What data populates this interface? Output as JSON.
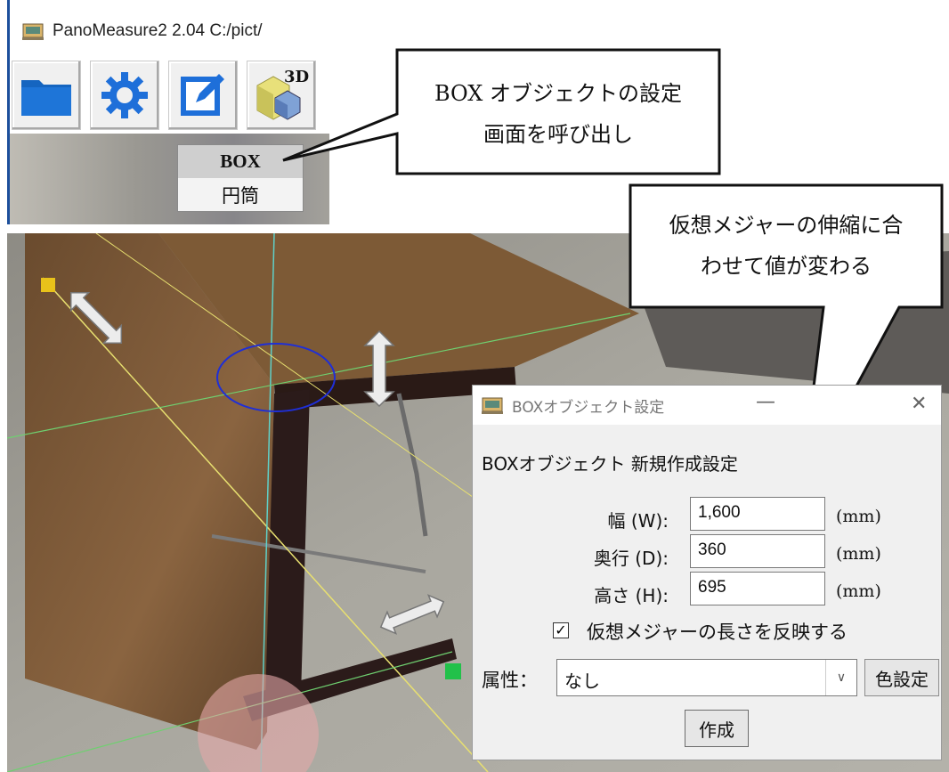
{
  "app": {
    "title": "PanoMeasure2 2.04  C:/pict/",
    "toolbar": {
      "buttons": [
        {
          "name": "open-folder",
          "icon": "folder-icon"
        },
        {
          "name": "settings",
          "icon": "gear-icon"
        },
        {
          "name": "edit",
          "icon": "edit-icon"
        },
        {
          "name": "3d-object",
          "icon": "3d-box-icon",
          "badge": "3D"
        }
      ]
    },
    "shape_menu": {
      "items": [
        "BOX",
        "円筒"
      ],
      "selected": "BOX"
    }
  },
  "callouts": {
    "box_settings": {
      "line1": "BOX オブジェクトの設定",
      "line2": "画面を呼び出し"
    },
    "measure_note": {
      "line1": "仮想メジャーの伸縮に合",
      "line2": "わせて値が変わる"
    }
  },
  "dialog": {
    "title": "BOXオブジェクト設定",
    "minimize": "—",
    "close": "✕",
    "heading": "BOXオブジェクト 新規作成設定",
    "fields": [
      {
        "label": "幅 (W):",
        "value": "1,600",
        "unit": "(mm)"
      },
      {
        "label": "奥行 (D):",
        "value": "360",
        "unit": "(mm)"
      },
      {
        "label": "高さ (H):",
        "value": "695",
        "unit": "(mm)"
      }
    ],
    "checkbox": {
      "label": "仮想メジャーの長さを反映する",
      "checked": true,
      "mark": "✓"
    },
    "attribute": {
      "label": "属性：",
      "value": "なし",
      "dropdown": "∨"
    },
    "color_button": "色設定",
    "create_button": "作成"
  },
  "colors": {
    "title_accent": "#1c4f9c",
    "folder_blue": "#1565c0",
    "gear_blue": "#1e6fd9",
    "handle_yellow": "#e8c21a",
    "handle_green": "#22c14a",
    "ellipse_blue": "#1f2fd6"
  }
}
